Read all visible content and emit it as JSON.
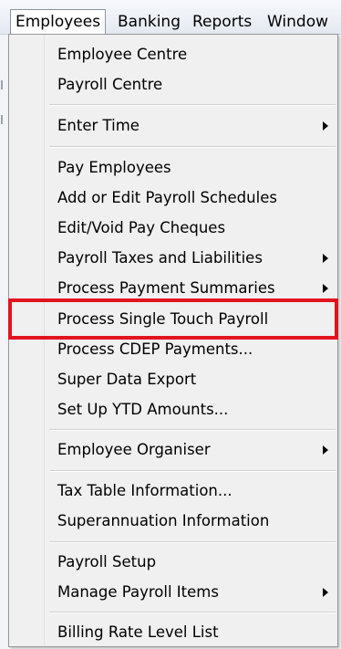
{
  "menubar": {
    "items": [
      {
        "label": "Employees",
        "active": true
      },
      {
        "label": "Banking",
        "active": false
      },
      {
        "label": "Reports",
        "active": false
      },
      {
        "label": "Window",
        "active": false
      }
    ]
  },
  "dropdown": {
    "items": [
      {
        "label": "Employee Centre",
        "has_submenu": false
      },
      {
        "label": "Payroll Centre",
        "has_submenu": false
      },
      {
        "label": "Enter Time",
        "has_submenu": true
      },
      {
        "label": "Pay Employees",
        "has_submenu": false
      },
      {
        "label": "Add or Edit Payroll Schedules",
        "has_submenu": false
      },
      {
        "label": "Edit/Void Pay Cheques",
        "has_submenu": false
      },
      {
        "label": "Payroll Taxes and Liabilities",
        "has_submenu": true
      },
      {
        "label": "Process Payment Summaries",
        "has_submenu": true
      },
      {
        "label": "Process Single Touch Payroll",
        "has_submenu": false,
        "highlighted": true
      },
      {
        "label": "Process CDEP Payments...",
        "has_submenu": false
      },
      {
        "label": "Super Data Export",
        "has_submenu": false
      },
      {
        "label": "Set Up YTD Amounts...",
        "has_submenu": false
      },
      {
        "label": "Employee Organiser",
        "has_submenu": true
      },
      {
        "label": "Tax Table Information...",
        "has_submenu": false
      },
      {
        "label": "Superannuation Information",
        "has_submenu": false
      },
      {
        "label": "Payroll Setup",
        "has_submenu": false
      },
      {
        "label": "Manage Payroll Items",
        "has_submenu": true
      },
      {
        "label": "Billing Rate Level List",
        "has_submenu": false
      }
    ]
  },
  "colors": {
    "highlight_border": "#e2141f",
    "menu_background": "#f0f0f0"
  }
}
